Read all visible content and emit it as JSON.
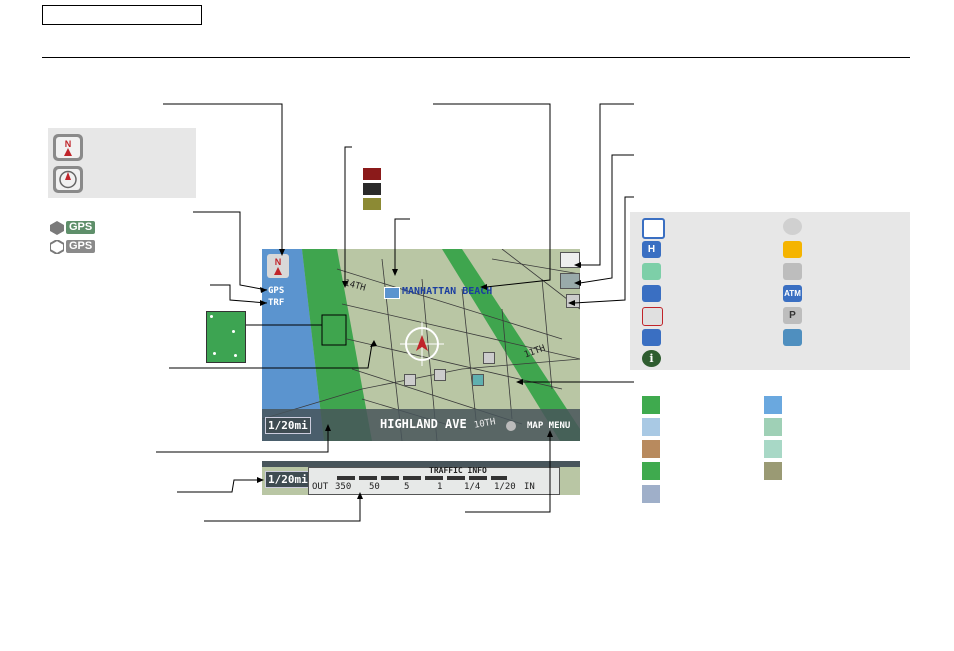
{
  "map": {
    "city_label": "MANHATTAN BEACH",
    "street_label": "HIGHLAND AVE",
    "scale_label": "1/20mi",
    "map_menu_label": "MAP MENU",
    "gps_label": "GPS",
    "traffic_label": "TRF",
    "street_14th": "14TH",
    "street_11th": "11TH",
    "street_10th": "10TH"
  },
  "icon_legends": {
    "gps_full": "GPS",
    "gps_partial": "GPS"
  },
  "traffic_bar": {
    "title": "TRAFFIC INFO",
    "scale_label": "1/20mi",
    "out_label": "OUT",
    "in_label": "IN",
    "steps": [
      "350",
      "50",
      "5",
      "1",
      "1/4",
      "1/20"
    ]
  },
  "poi_icons": {
    "atm_label": "ATM",
    "parking_label": "P",
    "hospital_label": "H",
    "info_label": "i"
  },
  "colors": {
    "traffic_red": "#8b1a1a",
    "traffic_black": "#2a2a2a",
    "traffic_olive": "#8c8a34",
    "ocean": "#5d93cc",
    "green": "#3faa4e"
  }
}
